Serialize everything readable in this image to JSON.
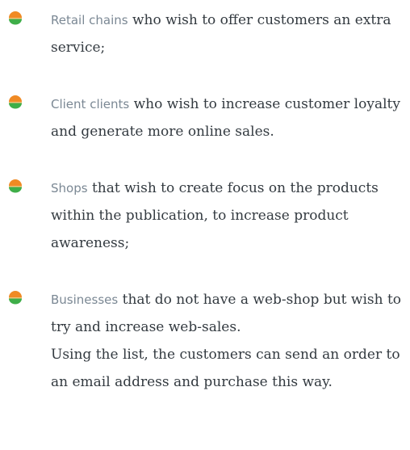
{
  "colors": {
    "bullet_top": "#f08a24",
    "bullet_bottom": "#3fae49",
    "keyword": "#7b8894",
    "body_text": "#333a40"
  },
  "bullet_icon": "orange-green-hemisphere-icon",
  "items": [
    {
      "keyword": "Retail chains",
      "text": " who wish to offer customers an extra service;"
    },
    {
      "keyword": "Client clients",
      "text": " who wish to increase customer loyalty and generate more online sales."
    },
    {
      "keyword": "Shops",
      "text": " that wish to create focus on the products within the publication, to increase product awareness;"
    },
    {
      "keyword": "Businesses",
      "text": " that do not have a web-shop but wish to try and increase web-sales.",
      "extra": "Using the list, the customers can send an order to an email address and purchase this way."
    }
  ]
}
